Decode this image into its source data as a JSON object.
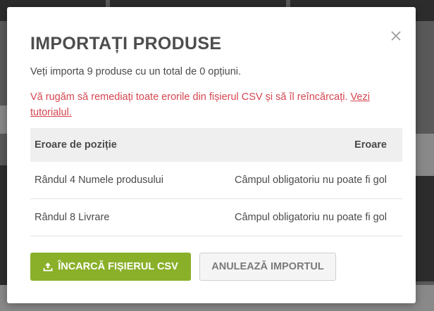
{
  "modal": {
    "title": "IMPORTAȚI PRODUSE",
    "info_text": "Veți importa 9 produse cu un total de 0 opțiuni.",
    "error_text": "Vă rugăm să remediați toate erorile din fișierul CSV și să îl reîncărcați.",
    "tutorial_link": "Vezi tutorialul.",
    "close_icon": "close-icon",
    "table": {
      "columns": [
        "Eroare de poziție",
        "Eroare"
      ],
      "rows": [
        [
          "Rândul 4 Numele produsului",
          "Câmpul obligatoriu nu poate fi gol"
        ],
        [
          "Rândul 8 Livrare",
          "Câmpul obligatoriu nu poate fi gol"
        ]
      ]
    },
    "buttons": {
      "upload_label": "ÎNCARCĂ FIȘIERUL CSV",
      "upload_icon": "upload-icon",
      "cancel_label": "ANULEAZĂ IMPORTUL"
    }
  },
  "colors": {
    "accent_green": "#8ab02a",
    "error_red": "#d64550",
    "title_gray": "#4d4d4d"
  }
}
